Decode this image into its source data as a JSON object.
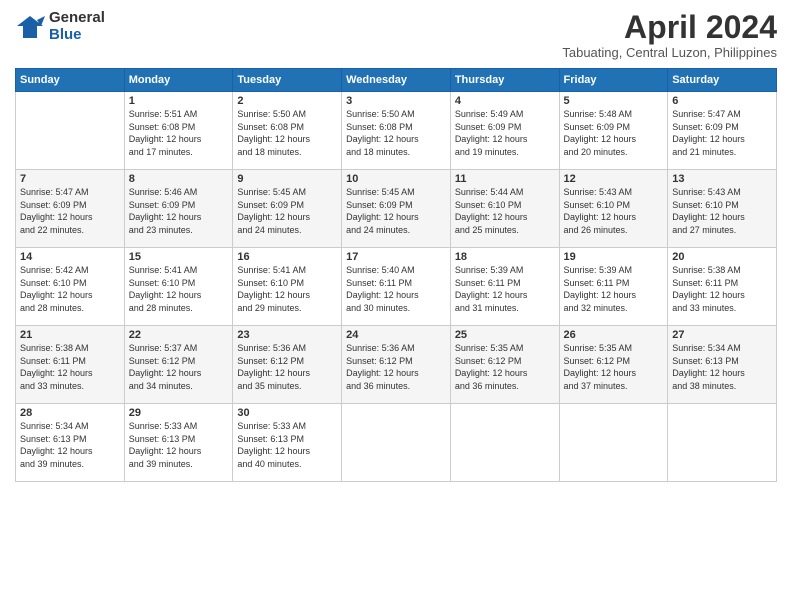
{
  "header": {
    "logo_general": "General",
    "logo_blue": "Blue",
    "month_title": "April 2024",
    "location": "Tabuating, Central Luzon, Philippines"
  },
  "calendar": {
    "days_of_week": [
      "Sunday",
      "Monday",
      "Tuesday",
      "Wednesday",
      "Thursday",
      "Friday",
      "Saturday"
    ],
    "weeks": [
      [
        {
          "day": "",
          "info": ""
        },
        {
          "day": "1",
          "info": "Sunrise: 5:51 AM\nSunset: 6:08 PM\nDaylight: 12 hours\nand 17 minutes."
        },
        {
          "day": "2",
          "info": "Sunrise: 5:50 AM\nSunset: 6:08 PM\nDaylight: 12 hours\nand 18 minutes."
        },
        {
          "day": "3",
          "info": "Sunrise: 5:50 AM\nSunset: 6:08 PM\nDaylight: 12 hours\nand 18 minutes."
        },
        {
          "day": "4",
          "info": "Sunrise: 5:49 AM\nSunset: 6:09 PM\nDaylight: 12 hours\nand 19 minutes."
        },
        {
          "day": "5",
          "info": "Sunrise: 5:48 AM\nSunset: 6:09 PM\nDaylight: 12 hours\nand 20 minutes."
        },
        {
          "day": "6",
          "info": "Sunrise: 5:47 AM\nSunset: 6:09 PM\nDaylight: 12 hours\nand 21 minutes."
        }
      ],
      [
        {
          "day": "7",
          "info": "Sunrise: 5:47 AM\nSunset: 6:09 PM\nDaylight: 12 hours\nand 22 minutes."
        },
        {
          "day": "8",
          "info": "Sunrise: 5:46 AM\nSunset: 6:09 PM\nDaylight: 12 hours\nand 23 minutes."
        },
        {
          "day": "9",
          "info": "Sunrise: 5:45 AM\nSunset: 6:09 PM\nDaylight: 12 hours\nand 24 minutes."
        },
        {
          "day": "10",
          "info": "Sunrise: 5:45 AM\nSunset: 6:09 PM\nDaylight: 12 hours\nand 24 minutes."
        },
        {
          "day": "11",
          "info": "Sunrise: 5:44 AM\nSunset: 6:10 PM\nDaylight: 12 hours\nand 25 minutes."
        },
        {
          "day": "12",
          "info": "Sunrise: 5:43 AM\nSunset: 6:10 PM\nDaylight: 12 hours\nand 26 minutes."
        },
        {
          "day": "13",
          "info": "Sunrise: 5:43 AM\nSunset: 6:10 PM\nDaylight: 12 hours\nand 27 minutes."
        }
      ],
      [
        {
          "day": "14",
          "info": "Sunrise: 5:42 AM\nSunset: 6:10 PM\nDaylight: 12 hours\nand 28 minutes."
        },
        {
          "day": "15",
          "info": "Sunrise: 5:41 AM\nSunset: 6:10 PM\nDaylight: 12 hours\nand 28 minutes."
        },
        {
          "day": "16",
          "info": "Sunrise: 5:41 AM\nSunset: 6:10 PM\nDaylight: 12 hours\nand 29 minutes."
        },
        {
          "day": "17",
          "info": "Sunrise: 5:40 AM\nSunset: 6:11 PM\nDaylight: 12 hours\nand 30 minutes."
        },
        {
          "day": "18",
          "info": "Sunrise: 5:39 AM\nSunset: 6:11 PM\nDaylight: 12 hours\nand 31 minutes."
        },
        {
          "day": "19",
          "info": "Sunrise: 5:39 AM\nSunset: 6:11 PM\nDaylight: 12 hours\nand 32 minutes."
        },
        {
          "day": "20",
          "info": "Sunrise: 5:38 AM\nSunset: 6:11 PM\nDaylight: 12 hours\nand 33 minutes."
        }
      ],
      [
        {
          "day": "21",
          "info": "Sunrise: 5:38 AM\nSunset: 6:11 PM\nDaylight: 12 hours\nand 33 minutes."
        },
        {
          "day": "22",
          "info": "Sunrise: 5:37 AM\nSunset: 6:12 PM\nDaylight: 12 hours\nand 34 minutes."
        },
        {
          "day": "23",
          "info": "Sunrise: 5:36 AM\nSunset: 6:12 PM\nDaylight: 12 hours\nand 35 minutes."
        },
        {
          "day": "24",
          "info": "Sunrise: 5:36 AM\nSunset: 6:12 PM\nDaylight: 12 hours\nand 36 minutes."
        },
        {
          "day": "25",
          "info": "Sunrise: 5:35 AM\nSunset: 6:12 PM\nDaylight: 12 hours\nand 36 minutes."
        },
        {
          "day": "26",
          "info": "Sunrise: 5:35 AM\nSunset: 6:12 PM\nDaylight: 12 hours\nand 37 minutes."
        },
        {
          "day": "27",
          "info": "Sunrise: 5:34 AM\nSunset: 6:13 PM\nDaylight: 12 hours\nand 38 minutes."
        }
      ],
      [
        {
          "day": "28",
          "info": "Sunrise: 5:34 AM\nSunset: 6:13 PM\nDaylight: 12 hours\nand 39 minutes."
        },
        {
          "day": "29",
          "info": "Sunrise: 5:33 AM\nSunset: 6:13 PM\nDaylight: 12 hours\nand 39 minutes."
        },
        {
          "day": "30",
          "info": "Sunrise: 5:33 AM\nSunset: 6:13 PM\nDaylight: 12 hours\nand 40 minutes."
        },
        {
          "day": "",
          "info": ""
        },
        {
          "day": "",
          "info": ""
        },
        {
          "day": "",
          "info": ""
        },
        {
          "day": "",
          "info": ""
        }
      ]
    ]
  }
}
